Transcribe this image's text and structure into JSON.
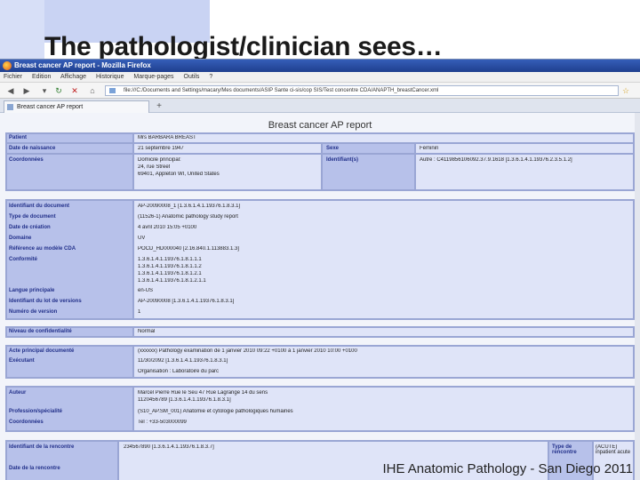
{
  "slide": {
    "title": "The pathologist/clinician sees…",
    "footer": "IHE Anatomic Pathology - San Diego 2011"
  },
  "browser": {
    "window_title": "Breast cancer AP report - Mozilla Firefox",
    "menu": [
      "Fichier",
      "Edition",
      "Affichage",
      "Historique",
      "Marque-pages",
      "Outils",
      "?"
    ],
    "url": "file:///C:/Documents and Settings/macary/Mes documents/ASIP Sante ci-sis/cop SIS/Test concentre CDA/ANAPTH_breastCancer.xml",
    "tab_label": "Breast cancer AP report",
    "new_tab": "+"
  },
  "report": {
    "title": "Breast cancer AP report",
    "patient": {
      "patient_label": "Patient",
      "patient_value": "Mrs BARBARA BREAST",
      "dob_label": "Date de naissance",
      "dob_value": "21 septembre 1947",
      "sexe_label": "Sexe",
      "sexe_value": "Féminin",
      "coord_label": "Coordonnées",
      "coord_value_1": "Domicile principal:",
      "coord_value_2": "24, rue Street",
      "coord_value_3": "69401, Appleton  WI, United States",
      "ident_label": "Identifiant(s)",
      "ident_value": "Autre : C4119856106092.37.9.1618 [1.3.6.1.4.1.19376.2.3.5.1.2]"
    },
    "document": {
      "id_label": "Identifiant du document",
      "id_value": "AP-20090008_1 [1.3.6.1.4.1.19376.1.8.3.1]",
      "type_label": "Type de document",
      "type_value": "(11526-1) Anatomic pathology study report",
      "date_label": "Date de création",
      "date_value": "4 avril 2010 15:05 +0100",
      "domain_label": "Domaine",
      "domain_value": "UV",
      "ref_label": "Référence au modèle CDA",
      "ref_value": "POCD_HD000040 [2.16.840.1.113883.1.3]",
      "conf_label": "Conformité",
      "conf_values": [
        "1.3.6.1.4.1.19376.1.8.1.1.1",
        "1.3.6.1.4.1.19376.1.8.1.1.2",
        "1.3.6.1.4.1.19376.1.8.1.2.1",
        "1.3.6.1.4.1.19376.1.8.1.2.1.1"
      ],
      "lang_label": "Langue principale",
      "lang_value": "en-US",
      "set_label": "Identifiant du lot de versions",
      "set_value": "AP-20090008 [1.3.6.1.4.1.19376.1.8.3.1]",
      "version_label": "Numéro de version",
      "version_value": "1"
    },
    "confidentiality": {
      "label": "Niveau de confidentialité",
      "value": "Normal"
    },
    "act": {
      "act_label": "Acte principal documenté",
      "act_value": "(xxxxxx) Pathology examination  de 1 janvier 2010 09:22 +0100 à 1 janvier 2010 10:00 +0100",
      "exec_label": "Exécutant",
      "exec_value_1": "11/30/2092 [1.3.6.1.4.1.19376.1.8.3.1]",
      "exec_value_2": "Organisation : Laboratoire du parc"
    },
    "author": {
      "author_label": "Auteur",
      "author_value_1": "Marcel Pierre  Rue le Seu 47 Rue Lagrange 14 du sens",
      "author_value_2": "1120456789 [1.3.6.1.4.1.19376.1.8.3.1]",
      "prof_label": "Profession/spécialité",
      "prof_value": "(S10_AP.SM_001) Anatomie et cytologie pathologiques humaines",
      "coord_label": "Coordonnées",
      "coord_value": "Tel : +33-503000099"
    },
    "encounter": {
      "id_label": "Identifiant de la rencontre",
      "id_value": "234567890 [1.3.6.1.4.1.19376.1.8.3.7]",
      "type_label": "Type de rencontre",
      "type_value": "(ACUTE) inpatient acute",
      "date_label": "Date de la rencontre"
    }
  }
}
